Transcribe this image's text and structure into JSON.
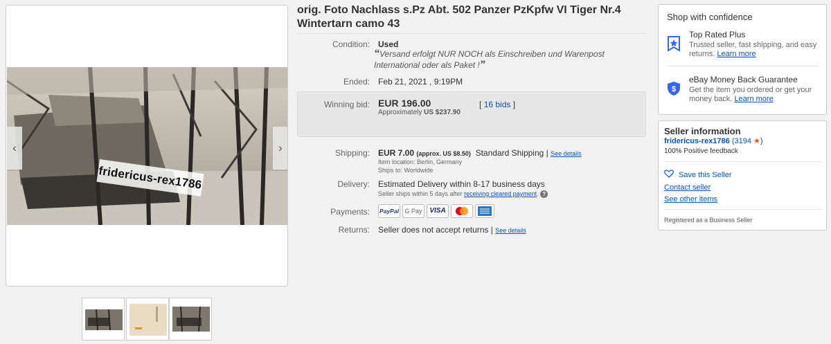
{
  "listing": {
    "title": "orig. Foto Nachlass s.Pz Abt. 502 Panzer PzKpfw VI Tiger Nr.4 Wintertarn camo 43"
  },
  "gallery": {
    "watermark": "fridericus-rex1786",
    "prev_icon": "‹",
    "next_icon": "›",
    "thumbnail_count": 3
  },
  "details": {
    "condition": {
      "label": "Condition:",
      "value": "Used",
      "note": "Versand erfolgt NUR NOCH als Einschreiben und Warenpost International oder als Paket !",
      "open_quote": "“",
      "close_quote": "”"
    },
    "ended": {
      "label": "Ended:",
      "value": "Feb 21, 2021 , 9:19PM"
    },
    "winning_bid": {
      "label": "Winning bid:",
      "amount": "EUR 196.00",
      "bids_open": "[",
      "bids": "16 bids",
      "bids_close": "]",
      "approx_label": "Approximately",
      "approx_value": "US $237.90"
    },
    "shipping": {
      "label": "Shipping:",
      "amount": "EUR 7.00",
      "approx": "(approx. US $8.50)",
      "method": "Standard Shipping",
      "sep": "|",
      "see_details": "See details",
      "location": "Item location:  Berlin, Germany",
      "ships_to": "Ships to:  Worldwide"
    },
    "delivery": {
      "label": "Delivery:",
      "value": "Estimated Delivery within 8-17 business days",
      "note_prefix": "Seller ships within 5 days after",
      "note_link": "receiving cleared payment",
      "note_suffix": ".",
      "help_icon": "?"
    },
    "payments": {
      "label": "Payments:",
      "methods": [
        "PayPal",
        "G Pay",
        "VISA",
        "Mastercard",
        "American Express"
      ]
    },
    "returns": {
      "label": "Returns:",
      "value": "Seller does not accept returns",
      "sep": "|",
      "see_details": "See details"
    }
  },
  "confidence": {
    "title": "Shop with confidence",
    "items": [
      {
        "heading": "Top Rated Plus",
        "desc": "Trusted seller, fast shipping, and easy returns.",
        "link": "Learn more"
      },
      {
        "heading": "eBay Money Back Guarantee",
        "desc": "Get the item you ordered or get your money back.",
        "link": "Learn more"
      }
    ]
  },
  "seller": {
    "title": "Seller information",
    "name": "fridericus-rex1786",
    "score": "(3194",
    "score_close": ")",
    "feedback": "100% Positive feedback",
    "save": "Save this Seller",
    "contact": "Contact seller",
    "other": "See other items",
    "registered": "Registered as a Business Seller"
  },
  "colors": {
    "link": "#0654ba",
    "star": "#e4572e",
    "badge_blue": "#3665f3"
  }
}
